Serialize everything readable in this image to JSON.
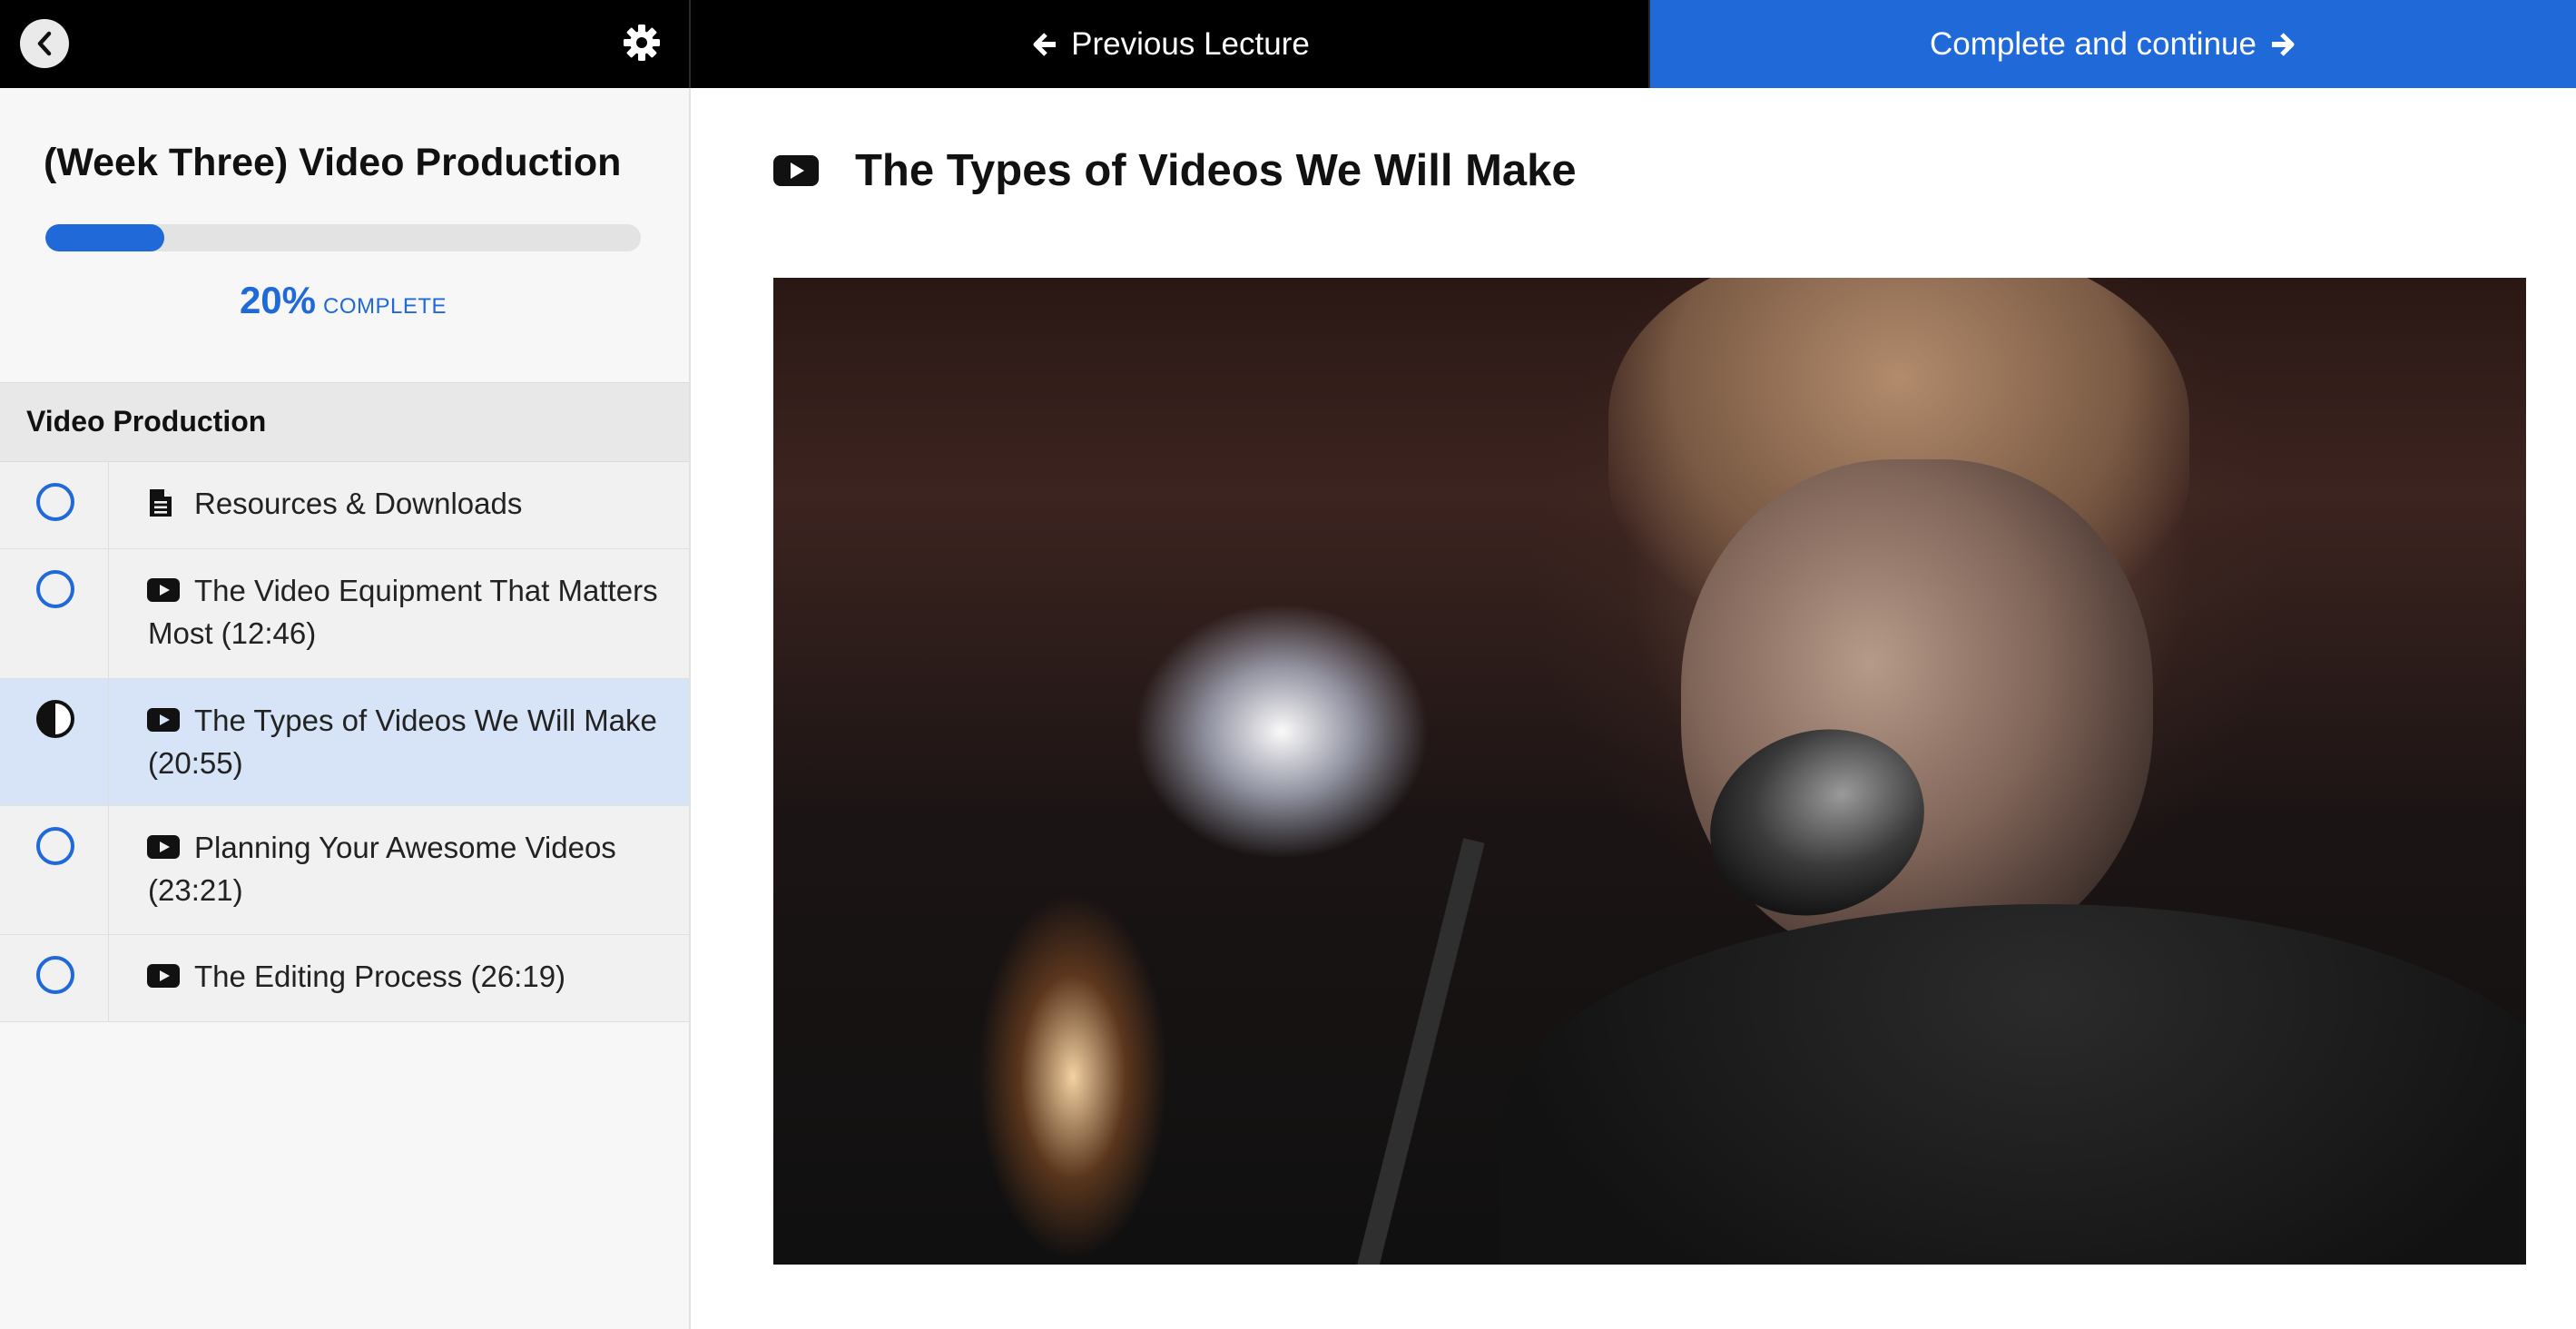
{
  "topbar": {
    "back_icon": "chevron-left-icon",
    "settings_icon": "gear-icon",
    "previous_label": "Previous Lecture",
    "complete_label": "Complete and continue"
  },
  "sidebar": {
    "course_title": "(Week Three) Video Production",
    "progress_percent": "20%",
    "progress_suffix": "COMPLETE",
    "progress_fraction": 0.2,
    "section_title": "Video Production",
    "lectures": [
      {
        "line1": "Resources & Downloads",
        "line2": "",
        "type_icon": "document-icon",
        "status": "not-started",
        "active": false
      },
      {
        "line1": "The Video Equipment That Matters",
        "line2": "Most (12:46)",
        "type_icon": "play-icon",
        "status": "not-started",
        "active": false
      },
      {
        "line1": "The Types of Videos We Will Make",
        "line2": "(20:55)",
        "type_icon": "play-icon",
        "status": "in-progress",
        "active": true
      },
      {
        "line1": "Planning Your Awesome Videos",
        "line2": "(23:21)",
        "type_icon": "play-icon",
        "status": "not-started",
        "active": false
      },
      {
        "line1": "The Editing Process (26:19)",
        "line2": "",
        "type_icon": "play-icon",
        "status": "not-started",
        "active": false
      }
    ]
  },
  "main": {
    "heading_icon": "play-icon",
    "lecture_title": "The Types of Videos We Will Make"
  },
  "colors": {
    "accent": "#2069d8",
    "topbar_bg": "#000000",
    "active_row": "#d7e4f7"
  }
}
